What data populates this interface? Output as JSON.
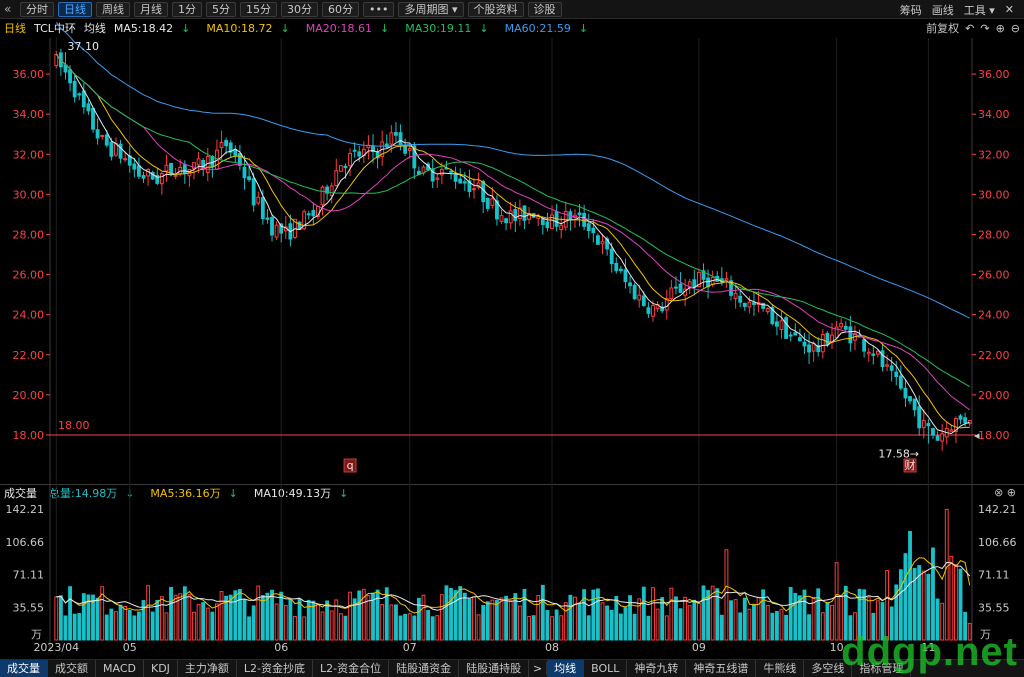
{
  "toolbar": {
    "back_icon": "chevron-left-icon",
    "buttons": [
      {
        "label": "分时",
        "active": false
      },
      {
        "label": "日线",
        "active": true
      },
      {
        "label": "周线",
        "active": false
      },
      {
        "label": "月线",
        "active": false
      },
      {
        "label": "1分",
        "active": false
      },
      {
        "label": "5分",
        "active": false
      },
      {
        "label": "15分",
        "active": false
      },
      {
        "label": "30分",
        "active": false
      },
      {
        "label": "60分",
        "active": false
      },
      {
        "label": "•••",
        "active": false
      },
      {
        "label": "多周期图 ▾",
        "active": false
      },
      {
        "label": "个股资料",
        "active": false
      },
      {
        "label": "诊股",
        "active": false
      }
    ],
    "right": {
      "chips": "筹码",
      "draw": "画线",
      "tools": "工具 ▾",
      "gear_icon": "gear-icon",
      "close": "✕"
    }
  },
  "main_legend": {
    "period": "日线",
    "stock": "TCL中环",
    "ma_label": "均线",
    "ma5": {
      "text": "MA5:18.42",
      "arrow": "↓",
      "color": "#e8e8e8"
    },
    "ma10": {
      "text": "MA10:18.72",
      "arrow": "↓",
      "color": "#f2c200"
    },
    "ma20": {
      "text": "MA20:18.61",
      "arrow": "↓",
      "color": "#e040c0"
    },
    "ma30": {
      "text": "MA30:19.11",
      "arrow": "↓",
      "color": "#22c05a"
    },
    "ma60": {
      "text": "MA60:21.59",
      "arrow": "↓",
      "color": "#3a9cf0"
    }
  },
  "main_right": {
    "adjust": "前复权",
    "icons": [
      "undo-icon",
      "redo-icon",
      "zoom-in-icon",
      "zoom-out-icon"
    ],
    "icon_glyphs": [
      "↶",
      "↷",
      "⊕",
      "⊖"
    ]
  },
  "colors": {
    "up": "#ff3b3b",
    "down": "#18c0c8",
    "axis": "#ff4040",
    "ma5": "#e8e8e8",
    "ma10": "#f2c200",
    "ma20": "#e040c0",
    "ma30": "#22c05a",
    "ma60": "#3a9cf0",
    "hline": "#ff4040"
  },
  "chart_data": [
    {
      "type": "candlestick",
      "yticks": [
        36,
        34,
        32,
        30,
        28,
        26,
        24,
        22,
        20,
        18
      ],
      "ytick_labels": [
        "36.00",
        "34.00",
        "32.00",
        "30.00",
        "28.00",
        "26.00",
        "24.00",
        "22.00",
        "20.00",
        "18.00"
      ],
      "ylim": [
        17.0,
        37.8
      ],
      "x_labels": [
        {
          "label": "2023/04",
          "index": 0
        },
        {
          "label": "05",
          "index": 16
        },
        {
          "label": "06",
          "index": 49
        },
        {
          "label": "07",
          "index": 77
        },
        {
          "label": "08",
          "index": 108
        },
        {
          "label": "09",
          "index": 140
        },
        {
          "label": "10",
          "index": 170
        },
        {
          "label": "11",
          "index": 190
        }
      ],
      "annotations": [
        {
          "text": "37.10",
          "kind": "high",
          "index": 2,
          "value": 37.1
        },
        {
          "text": "17.58→",
          "kind": "low",
          "index": 190,
          "value": 17.58
        },
        {
          "text": "18.00",
          "kind": "hline",
          "value": 18.0
        }
      ],
      "markers": [
        {
          "text": "q",
          "index": 64
        },
        {
          "text": "财",
          "index": 186
        }
      ],
      "candles": []
    },
    {
      "type": "bar",
      "series_label": "成交量",
      "legend": [
        {
          "text": "总量:14.98万",
          "arrow": "↓",
          "color": "#18c0c8"
        },
        {
          "text": "MA5:36.16万",
          "arrow": "↓",
          "color": "#f2c200"
        },
        {
          "text": "MA10:49.13万",
          "arrow": "↓",
          "color": "#e8e8e8"
        }
      ],
      "yticks": [
        142.21,
        106.66,
        71.11,
        35.55
      ],
      "ytick_labels": [
        "142.21",
        "106.66",
        "71.11",
        "35.55"
      ],
      "unit": "万",
      "ylim": [
        0,
        150
      ],
      "values": []
    }
  ],
  "bottom_tabs_left": [
    {
      "label": "成交量",
      "active": true
    },
    {
      "label": "成交额",
      "active": false
    },
    {
      "label": "MACD",
      "active": false
    },
    {
      "label": "KDJ",
      "active": false
    },
    {
      "label": "主力净额",
      "active": false
    },
    {
      "label": "L2-资金抄底",
      "active": false
    },
    {
      "label": "L2-资金合位",
      "active": false
    },
    {
      "label": "陆股通资金",
      "active": false
    },
    {
      "label": "陆股通持股",
      "active": false
    }
  ],
  "bottom_tabs_right": [
    {
      "label": "均线",
      "active": true
    },
    {
      "label": "BOLL",
      "active": false
    },
    {
      "label": "神奇九转",
      "active": false
    },
    {
      "label": "神奇五线谱",
      "active": false
    },
    {
      "label": "牛熊线",
      "active": false
    },
    {
      "label": "多空线",
      "active": false
    },
    {
      "label": "指标管理",
      "active": false
    }
  ],
  "bottom_arrow": ">",
  "watermark": "ddgp.net"
}
